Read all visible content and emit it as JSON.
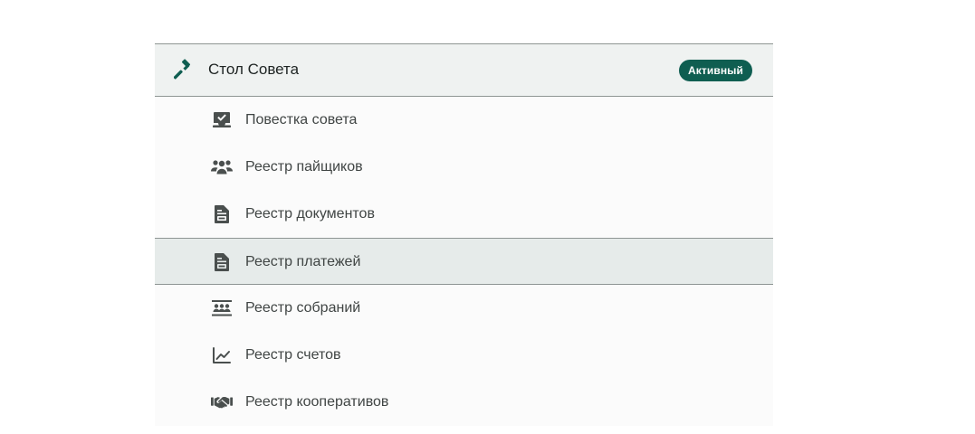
{
  "section": {
    "title": "Стол Совета",
    "badge": "Активный",
    "icon": "gavel-icon"
  },
  "items": [
    {
      "label": "Повестка совета",
      "icon": "inbox-check-icon"
    },
    {
      "label": "Реестр пайщиков",
      "icon": "people-icon"
    },
    {
      "label": "Реестр документов",
      "icon": "document-icon"
    },
    {
      "label": "Реестр платежей",
      "icon": "document-icon",
      "active": true
    },
    {
      "label": "Реестр собраний",
      "icon": "meeting-icon"
    },
    {
      "label": "Реестр счетов",
      "icon": "chart-line-icon"
    },
    {
      "label": "Реестр кооперативов",
      "icon": "handshake-icon"
    }
  ],
  "colors": {
    "accent": "#0f5e51",
    "header_bg": "#eff2f1",
    "active_bg": "#e6ebea",
    "icon": "#4a4f4e"
  }
}
